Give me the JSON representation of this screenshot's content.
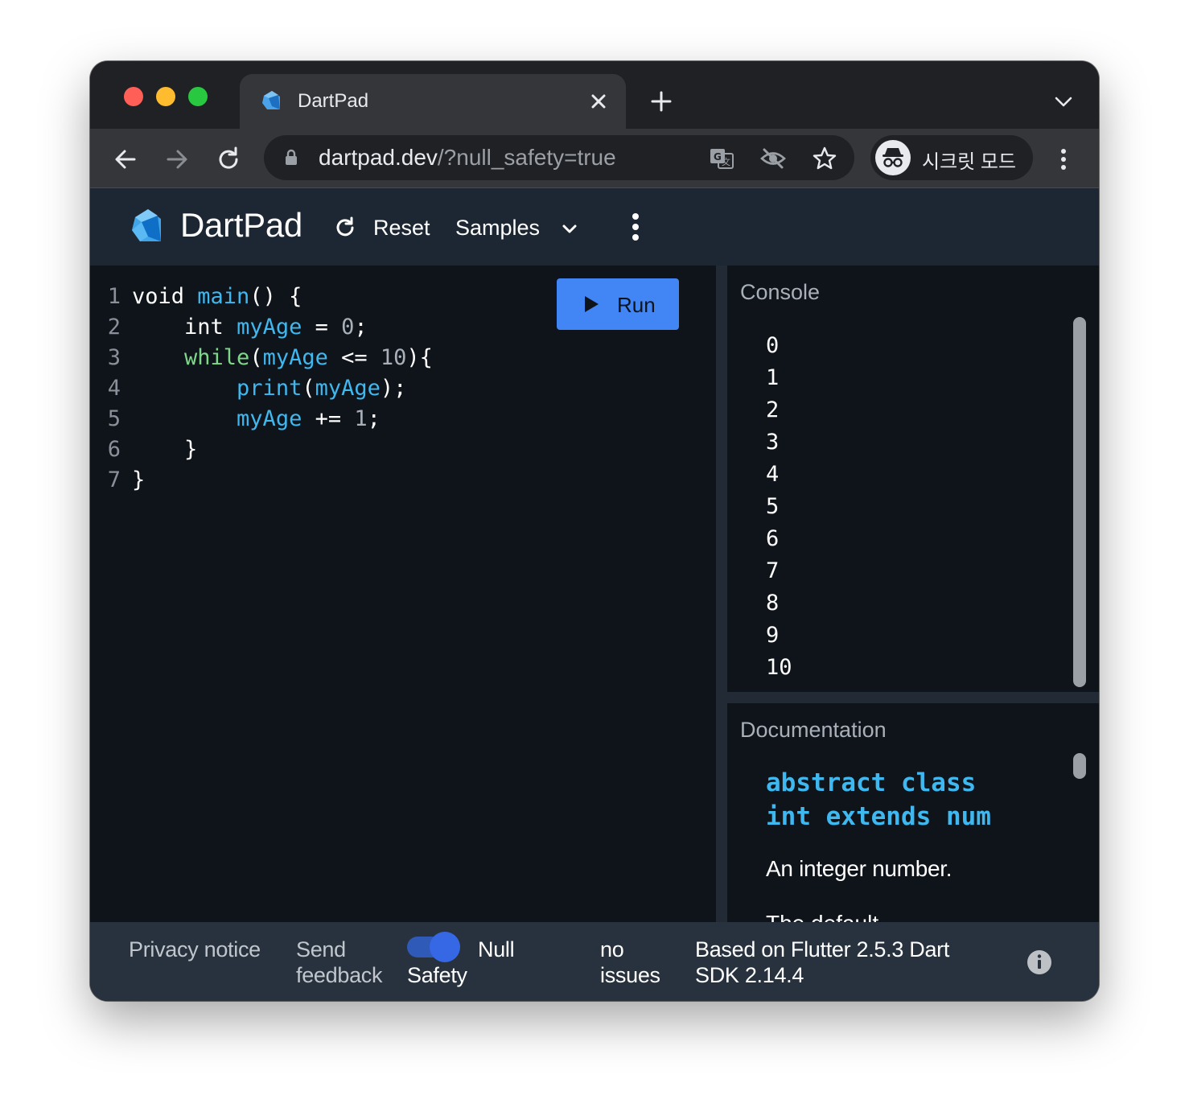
{
  "browser": {
    "tab": {
      "title": "DartPad"
    },
    "url": {
      "host": "dartpad.dev",
      "path": "/?null_safety=true"
    },
    "incognito_label": "시크릿 모드",
    "icons": [
      "back-icon",
      "forward-icon",
      "reload-icon",
      "lock-icon",
      "translate-icon",
      "eye-off-icon",
      "star-icon",
      "incognito-icon",
      "more-vert-icon"
    ]
  },
  "app": {
    "title": "DartPad",
    "reset_label": "Reset",
    "samples_label": "Samples",
    "run_label": "Run"
  },
  "editor": {
    "lines": [
      {
        "n": "1",
        "tokens": [
          [
            "kw",
            "void "
          ],
          [
            "fn",
            "main"
          ],
          [
            "p",
            "() {"
          ]
        ]
      },
      {
        "n": "2",
        "tokens": [
          [
            "p",
            "    "
          ],
          [
            "kw",
            "int "
          ],
          [
            "fn",
            "myAge"
          ],
          [
            "p",
            " = "
          ],
          [
            "num",
            "0"
          ],
          [
            "p",
            ";"
          ]
        ]
      },
      {
        "n": "3",
        "tokens": [
          [
            "p",
            "    "
          ],
          [
            "flow",
            "while"
          ],
          [
            "p",
            "("
          ],
          [
            "fn",
            "myAge"
          ],
          [
            "p",
            " <= "
          ],
          [
            "num",
            "10"
          ],
          [
            "p",
            "){"
          ]
        ]
      },
      {
        "n": "4",
        "tokens": [
          [
            "p",
            "        "
          ],
          [
            "fn",
            "print"
          ],
          [
            "p",
            "("
          ],
          [
            "fn",
            "myAge"
          ],
          [
            "p",
            ");"
          ]
        ]
      },
      {
        "n": "5",
        "tokens": [
          [
            "p",
            "        "
          ],
          [
            "fn",
            "myAge"
          ],
          [
            "p",
            " += "
          ],
          [
            "num",
            "1"
          ],
          [
            "p",
            ";"
          ]
        ]
      },
      {
        "n": "6",
        "tokens": [
          [
            "p",
            "    }"
          ]
        ]
      },
      {
        "n": "7",
        "tokens": [
          [
            "p",
            "}"
          ]
        ]
      }
    ]
  },
  "console": {
    "title": "Console",
    "output": [
      "0",
      "1",
      "2",
      "3",
      "4",
      "5",
      "6",
      "7",
      "8",
      "9",
      "10"
    ]
  },
  "docs": {
    "title": "Documentation",
    "signature": "abstract class int extends num",
    "description": "An integer number.",
    "more": "The default"
  },
  "footer": {
    "privacy": "Privacy notice",
    "feedback": "Send feedback",
    "null_safety": "Null Safety",
    "null_safety_on": true,
    "issues": "no issues",
    "version": "Based on Flutter 2.5.3 Dart SDK 2.14.4"
  },
  "colors": {
    "accent": "#4285f4",
    "code_function": "#3fb8f0",
    "code_flow": "#7fd88a",
    "header_bg": "#1d2733"
  }
}
